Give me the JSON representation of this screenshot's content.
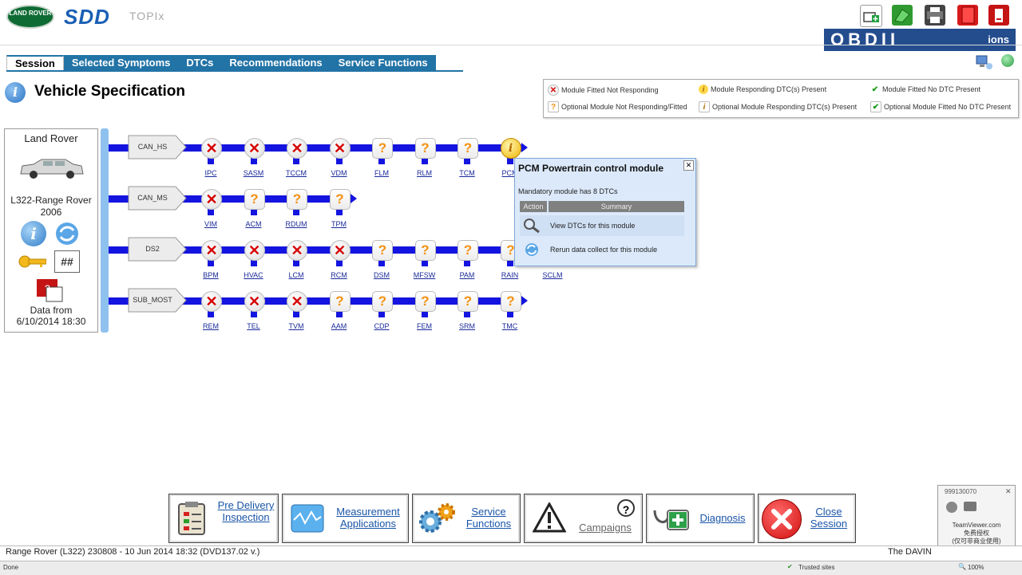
{
  "header": {
    "logo_text": "LAND ROVER",
    "app_name": "SDD",
    "sub_app": "TOPIx",
    "watermark": "OBDII",
    "watermark_suffix": "ions"
  },
  "tabs": [
    {
      "label": "Session",
      "active": true
    },
    {
      "label": "Selected Symptoms",
      "active": false
    },
    {
      "label": "DTCs",
      "active": false
    },
    {
      "label": "Recommendations",
      "active": false
    },
    {
      "label": "Service Functions",
      "active": false
    }
  ],
  "page_title": "Vehicle Specification",
  "legend": {
    "items": [
      {
        "text": "Module Fitted Not Responding",
        "icon": "x"
      },
      {
        "text": "Module Responding DTC(s) Present",
        "icon": "info"
      },
      {
        "text": "Module Fitted No DTC Present",
        "icon": "check"
      },
      {
        "text": "Optional Module Not Responding/Fitted",
        "icon": "question"
      },
      {
        "text": "Optional Module Responding DTC(s) Present",
        "icon": "info-square"
      },
      {
        "text": "Optional Module Fitted No DTC Present",
        "icon": "check-square"
      }
    ]
  },
  "vehicle": {
    "make": "Land Rover",
    "model": "L322-Range Rover 2006",
    "hash_button": "##",
    "data_from_label": "Data from",
    "data_from_date": "6/10/2014 18:30"
  },
  "network": {
    "buses": [
      {
        "name": "CAN_HS",
        "modules": [
          {
            "code": "IPC",
            "status": "not_responding"
          },
          {
            "code": "SASM",
            "status": "not_responding"
          },
          {
            "code": "TCCM",
            "status": "not_responding"
          },
          {
            "code": "VDM",
            "status": "not_responding"
          },
          {
            "code": "FLM",
            "status": "optional"
          },
          {
            "code": "RLM",
            "status": "optional"
          },
          {
            "code": "TCM",
            "status": "optional"
          },
          {
            "code": "PCM",
            "status": "responding_dtc"
          }
        ]
      },
      {
        "name": "CAN_MS",
        "modules": [
          {
            "code": "VIM",
            "status": "not_responding"
          },
          {
            "code": "ACM",
            "status": "optional"
          },
          {
            "code": "RDUM",
            "status": "optional"
          },
          {
            "code": "TPM",
            "status": "optional"
          }
        ]
      },
      {
        "name": "DS2",
        "modules": [
          {
            "code": "BPM",
            "status": "not_responding"
          },
          {
            "code": "HVAC",
            "status": "not_responding"
          },
          {
            "code": "LCM",
            "status": "not_responding"
          },
          {
            "code": "RCM",
            "status": "not_responding"
          },
          {
            "code": "DSM",
            "status": "optional"
          },
          {
            "code": "MFSW",
            "status": "optional"
          },
          {
            "code": "PAM",
            "status": "optional"
          },
          {
            "code": "RAIN",
            "status": "optional"
          },
          {
            "code": "SCLM",
            "status": "optional"
          }
        ]
      },
      {
        "name": "SUB_MOST",
        "modules": [
          {
            "code": "REM",
            "status": "not_responding"
          },
          {
            "code": "TEL",
            "status": "not_responding"
          },
          {
            "code": "TVM",
            "status": "not_responding"
          },
          {
            "code": "AAM",
            "status": "optional"
          },
          {
            "code": "CDP",
            "status": "optional"
          },
          {
            "code": "FEM",
            "status": "optional"
          },
          {
            "code": "SRM",
            "status": "optional"
          },
          {
            "code": "TMC",
            "status": "optional"
          }
        ]
      }
    ]
  },
  "popup": {
    "title": "PCM Powertrain control module",
    "subtitle": "Mandatory module has 8 DTCs",
    "col_action": "Action",
    "col_summary": "Summary",
    "rows": [
      {
        "label": "View DTCs for this module",
        "icon": "magnifier-icon"
      },
      {
        "label": "Rerun data collect for this module",
        "icon": "refresh-icon"
      }
    ]
  },
  "bottom_buttons": [
    {
      "label": "Pre Delivery Inspection",
      "icon": "clipboard-icon"
    },
    {
      "label": "Measurement Applications",
      "icon": "waveform-icon"
    },
    {
      "label": "Service Functions",
      "icon": "gears-icon"
    },
    {
      "label": "Campaigns",
      "icon": "warning-icon"
    },
    {
      "label": "Diagnosis",
      "icon": "medkit-icon"
    },
    {
      "label": "Close Session",
      "icon": "close-icon"
    }
  ],
  "status_bar": {
    "left": "Range Rover (L322) 230808 - 10 Jun 2014 18:32 (DVD137.02 v.)",
    "right": "The DAVIN"
  },
  "ie_status": {
    "done": "Done",
    "zone": "Trusted sites",
    "zoom": "100%"
  },
  "teamviewer": {
    "id": "999130070",
    "line1": "TeamViewer.com",
    "line2": "免费授权",
    "line3": "(仅可非商业使用)"
  },
  "colors": {
    "tab_blue": "#2273a6",
    "bus_blue": "#1414e0",
    "error_red": "#d60000",
    "optional_orange": "#f29111",
    "link_blue": "#1a55a8"
  }
}
